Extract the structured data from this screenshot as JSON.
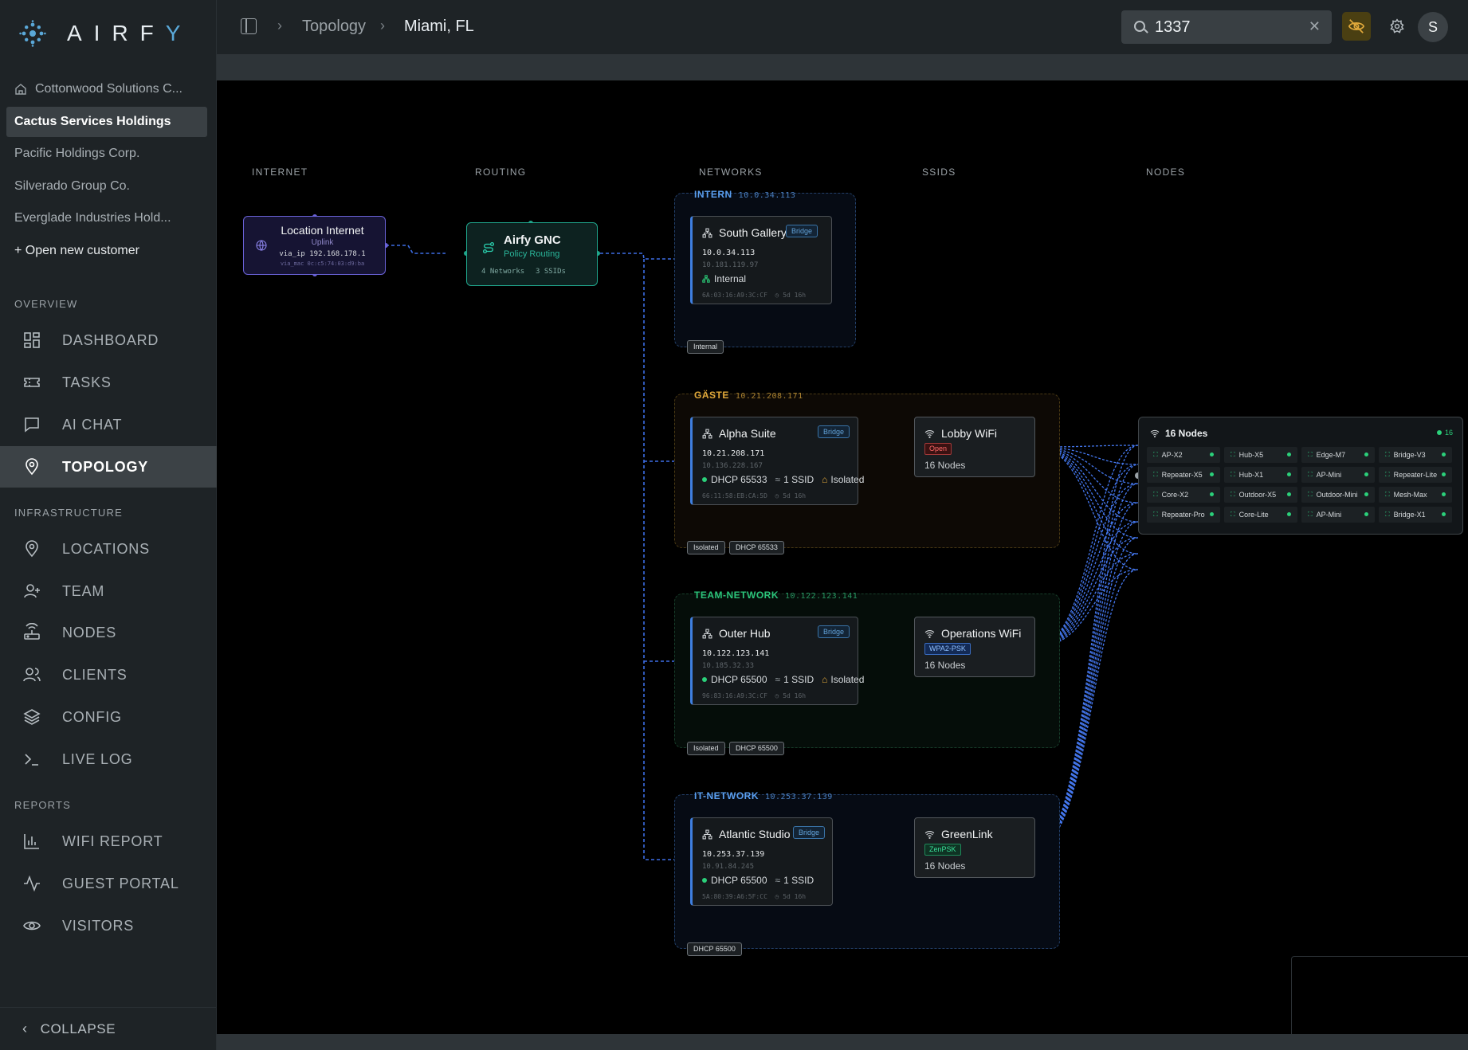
{
  "app": {
    "logo_text_main": "AIRF",
    "logo_text_accent": "Y"
  },
  "customers": [
    {
      "label": "Cottonwood Solutions C...",
      "active": false,
      "home": true
    },
    {
      "label": "Cactus Services Holdings",
      "active": true
    },
    {
      "label": "Pacific Holdings Corp.",
      "active": false
    },
    {
      "label": "Silverado Group Co.",
      "active": false
    },
    {
      "label": "Everglade Industries Hold...",
      "active": false
    },
    {
      "label": "+ Open new customer",
      "active": false
    }
  ],
  "sections": {
    "overview": "OVERVIEW",
    "infrastructure": "INFRASTRUCTURE",
    "reports": "REPORTS"
  },
  "nav": {
    "dashboard": "DASHBOARD",
    "tasks": "TASKS",
    "ai_chat": "AI CHAT",
    "topology": "TOPOLOGY",
    "locations": "LOCATIONS",
    "team": "TEAM",
    "nodes": "NODES",
    "clients": "CLIENTS",
    "config": "CONFIG",
    "live_log": "LIVE LOG",
    "wifi_report": "WIFI REPORT",
    "guest_portal": "GUEST PORTAL",
    "visitors": "VISITORS",
    "collapse": "COLLAPSE"
  },
  "header": {
    "breadcrumb": [
      "Topology",
      "Miami, FL"
    ],
    "search_value": "1337",
    "avatar_initial": "S"
  },
  "columns": [
    "INTERNET",
    "ROUTING",
    "NETWORKS",
    "SSIDS",
    "NODES"
  ],
  "internet": {
    "title": "Location Internet",
    "subtitle": "Uplink",
    "via_ip": "via_ip 192.168.178.1",
    "via_mac": "via_mac 0c:c5:74:03:d9:ba"
  },
  "gnc": {
    "title": "Airfy GNC",
    "subtitle": "Policy Routing",
    "networks": "4 Networks",
    "ssids": "3 SSIDs"
  },
  "groups": [
    {
      "name": "INTERN",
      "ip": "10.0.34.113",
      "color": "#5a9ff0",
      "tags": [
        "Internal"
      ],
      "card": {
        "title": "South Gallery",
        "badge": "Bridge",
        "ip": "10.0.34.113",
        "ip2": "10.181.119.97",
        "meta": "Internal",
        "mac": "6A:03:16:A9:3C:CF",
        "uptime": "5d 16h"
      }
    },
    {
      "name": "GÄSTE",
      "ip": "10.21.208.171",
      "color": "#e0a83a",
      "tags": [
        "Isolated",
        "DHCP 65533"
      ],
      "card": {
        "title": "Alpha Suite",
        "badge": "Bridge",
        "ip": "10.21.208.171",
        "ip2": "10.136.228.167",
        "dhcp": "DHCP 65533",
        "ssid_count": "1 SSID",
        "isolated": "Isolated",
        "mac": "66:11:58:EB:CA:5D",
        "uptime": "5d 16h"
      },
      "ssid": {
        "title": "Lobby WiFi",
        "badge": "Open",
        "nodes": "16 Nodes"
      }
    },
    {
      "name": "TEAM-NETWORK",
      "ip": "10.122.123.141",
      "color": "#2bc47a",
      "tags": [
        "Isolated",
        "DHCP 65500"
      ],
      "card": {
        "title": "Outer Hub",
        "badge": "Bridge",
        "ip": "10.122.123.141",
        "ip2": "10.185.32.33",
        "dhcp": "DHCP 65500",
        "ssid_count": "1 SSID",
        "isolated": "Isolated",
        "mac": "96:83:16:A9:3C:CF",
        "uptime": "5d 16h"
      },
      "ssid": {
        "title": "Operations WiFi",
        "badge": "WPA2-PSK",
        "nodes": "16 Nodes"
      }
    },
    {
      "name": "IT-NETWORK",
      "ip": "10.253.37.139",
      "color": "#5a9ff0",
      "tags": [
        "DHCP 65500"
      ],
      "card": {
        "title": "Atlantic Studio",
        "badge": "Bridge",
        "ip": "10.253.37.139",
        "ip2": "10.91.84.245",
        "dhcp": "DHCP 65500",
        "ssid_count": "1 SSID",
        "mac": "5A:80:39:A6:5F:CC",
        "uptime": "5d 16h"
      },
      "ssid": {
        "title": "GreenLink",
        "badge": "ZenPSK",
        "nodes": "16 Nodes"
      }
    }
  ],
  "nodes_panel": {
    "title": "16 Nodes",
    "count": "16",
    "nodes": [
      "AP-X2",
      "Hub-X5",
      "Edge-M7",
      "Bridge-V3",
      "Repeater-X5",
      "Hub-X1",
      "AP-Mini",
      "Repeater-Lite",
      "Core-X2",
      "Outdoor-X5",
      "Outdoor-Mini",
      "Mesh-Max",
      "Repeater-Pro",
      "Core-Lite",
      "AP-Mini",
      "Bridge-X1"
    ]
  }
}
